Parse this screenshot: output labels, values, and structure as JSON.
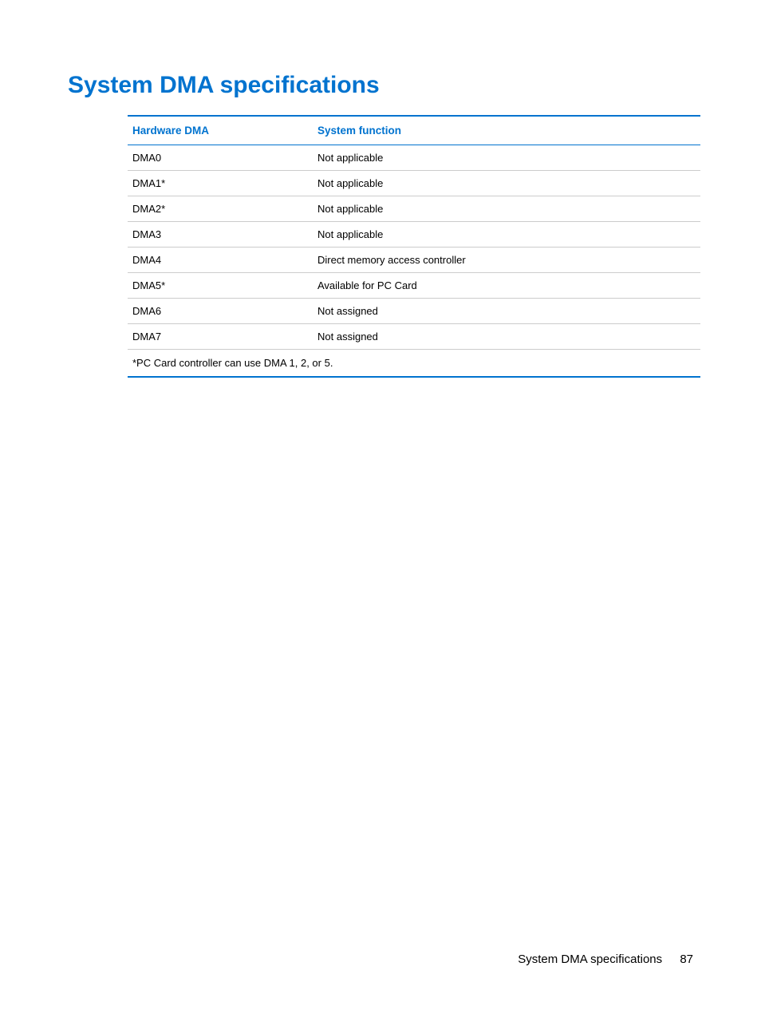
{
  "title": "System DMA specifications",
  "table": {
    "headers": {
      "col1": "Hardware DMA",
      "col2": "System function"
    },
    "rows": [
      {
        "hardware": "DMA0",
        "function": "Not applicable"
      },
      {
        "hardware": "DMA1*",
        "function": "Not applicable"
      },
      {
        "hardware": "DMA2*",
        "function": "Not applicable"
      },
      {
        "hardware": "DMA3",
        "function": "Not applicable"
      },
      {
        "hardware": "DMA4",
        "function": "Direct memory access controller"
      },
      {
        "hardware": "DMA5*",
        "function": "Available for PC Card"
      },
      {
        "hardware": "DMA6",
        "function": "Not assigned"
      },
      {
        "hardware": "DMA7",
        "function": "Not assigned"
      }
    ],
    "footnote": "*PC Card controller can use DMA 1, 2, or 5."
  },
  "footer": {
    "label": "System DMA specifications",
    "page": "87"
  }
}
